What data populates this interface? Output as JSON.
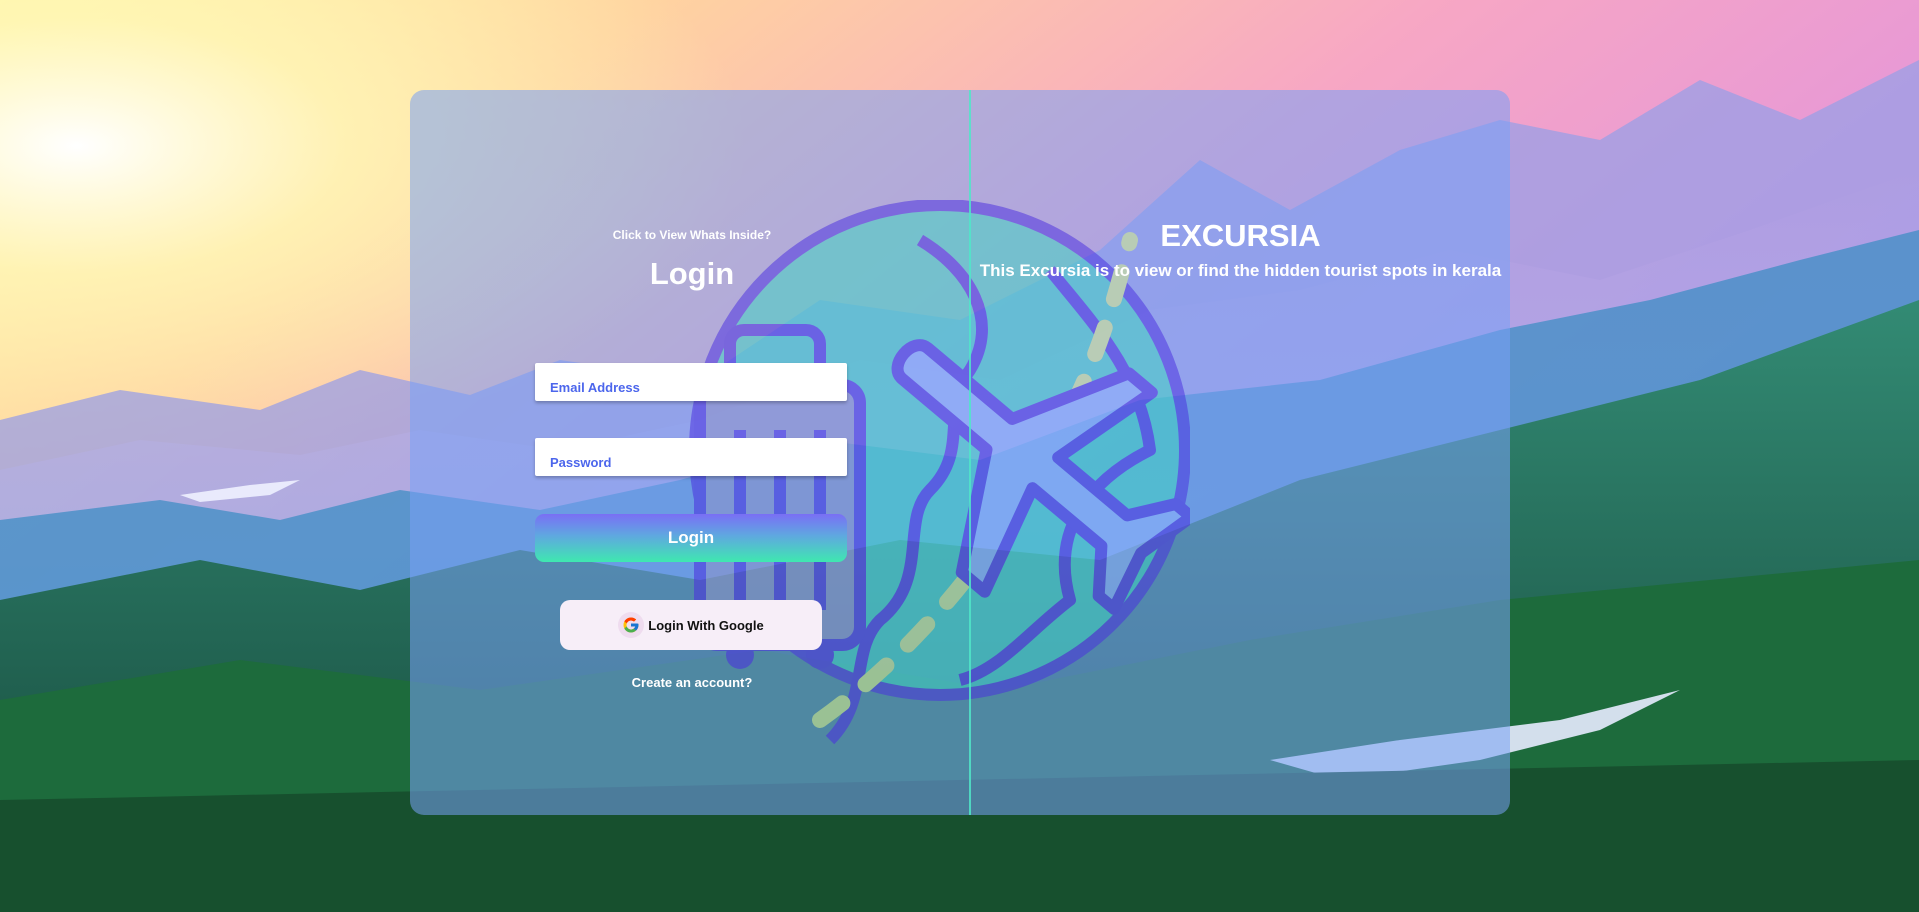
{
  "login_panel": {
    "hint": "Click to View Whats Inside?",
    "title": "Login",
    "email_placeholder": "Email Address",
    "password_placeholder": "Password",
    "login_button": "Login",
    "google_button": "Login With Google",
    "create_account_link": "Create an account?"
  },
  "brand_panel": {
    "title": "EXCURSIA",
    "description": "This Excursia is to view or find the hidden tourist spots in kerala"
  },
  "icons": {
    "google": "google-logo-icon",
    "emblem": "travel-globe-airplane-suitcase-icon"
  },
  "colors": {
    "card_overlay": "#78a0f5",
    "divider": "#50e6c8",
    "accent_text": "#4c66ec",
    "button_gradient_top": "#7a6ff5",
    "button_gradient_bottom": "#3fe8b0",
    "google_button_bg": "#f7eef8"
  }
}
